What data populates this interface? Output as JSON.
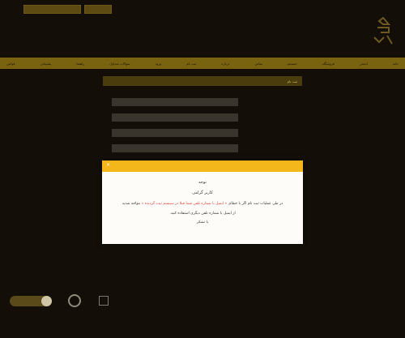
{
  "navbar": {
    "items": [
      "خانه",
      "انجمن",
      "فروشگاه",
      "جستجو",
      "تماس",
      "درباره",
      "ثبت نام",
      "ورود",
      "سوالات متداول",
      "راهنما",
      "پشتیبانی",
      "قوانین"
    ]
  },
  "panel": {
    "title": "ثبت نام"
  },
  "dialog": {
    "close": "×",
    "title": "توجه",
    "greeting": "کاربر گرامی",
    "message_prefix": "در طی عملیات ثبت نام اگر با خطای",
    "message_error": "« ایمیل یا شماره تلفن شما قبلا در سیستم ثبت گردیده »",
    "message_suffix": "مواجه شدید",
    "hint": "از ایمیل یا شماره تلفن دیگری استفاده کنید.",
    "thanks": "با تشکر"
  },
  "colors": {
    "accent": "#f3b71b",
    "nav": "#7a6310",
    "background": "#130f08"
  }
}
